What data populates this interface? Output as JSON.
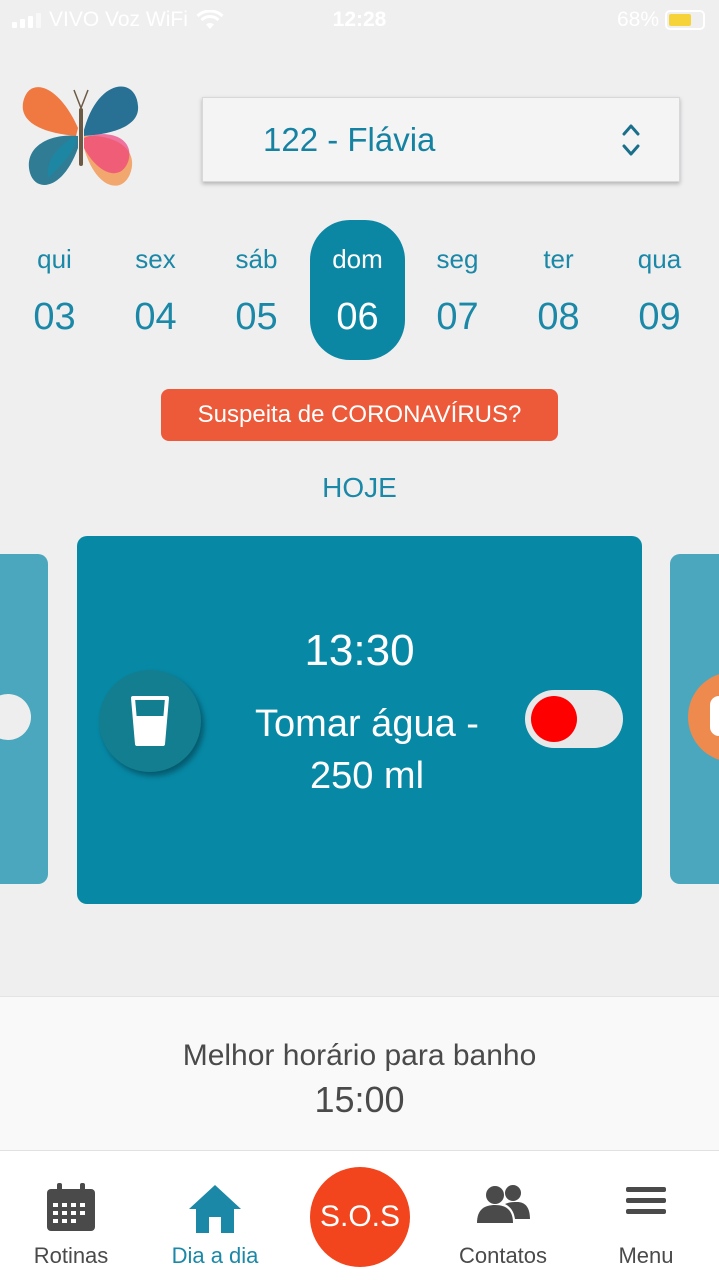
{
  "status_bar": {
    "carrier": "VIVO Voz WiFi",
    "time": "12:28",
    "battery": "68%",
    "battery_level": 0.68
  },
  "patient": {
    "selected": "122 - Flávia"
  },
  "days": [
    {
      "weekday": "qui",
      "day": "03"
    },
    {
      "weekday": "sex",
      "day": "04"
    },
    {
      "weekday": "sáb",
      "day": "05"
    },
    {
      "weekday": "dom",
      "day": "06",
      "active": true
    },
    {
      "weekday": "seg",
      "day": "07"
    },
    {
      "weekday": "ter",
      "day": "08"
    },
    {
      "weekday": "qua",
      "day": "09"
    }
  ],
  "corona_button": "Suspeita de CORONAVÍRUS?",
  "today_label": "HOJE",
  "task_card": {
    "time": "13:30",
    "title": "Tomar água - 250 ml",
    "icon": "water-glass-icon",
    "done": false
  },
  "bath": {
    "label": "Melhor horário para banho",
    "time": "15:00"
  },
  "nav": {
    "rotinas": "Rotinas",
    "dia_a_dia": "Dia a dia",
    "sos": "S.O.S",
    "contatos": "Contatos",
    "menu": "Menu"
  },
  "colors": {
    "primary": "#0789a6",
    "sos": "#f2451e",
    "corona": "#ec5a3a",
    "toggle_dot": "#ff0000"
  }
}
